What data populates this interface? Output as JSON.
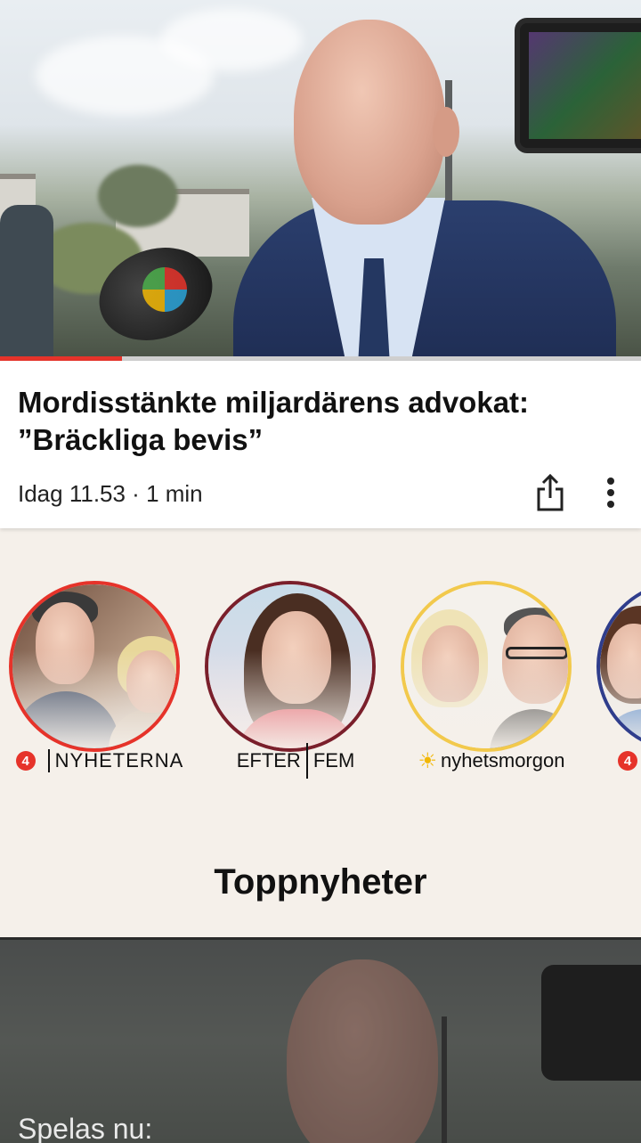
{
  "article": {
    "headline": "Mordisstänkte miljardärens advokat: ”Bräckliga bevis”",
    "meta": "Idag 11.53 · 1 min",
    "progress_percent": 19
  },
  "actions": {
    "share_icon": "share-icon",
    "more_icon": "more-vertical-icon"
  },
  "shows": [
    {
      "logo_badge": "4",
      "name": "NYHETERNA",
      "ring_color": "#e6332a"
    },
    {
      "name_left": "EFTER",
      "name_right": "FEM",
      "ring_color": "#7a1f2b"
    },
    {
      "name": "nyhetsmorgon",
      "ring_color": "#f2c94c"
    },
    {
      "logo_badge": "4",
      "ring_color": "#2f3d8c"
    }
  ],
  "section": {
    "title": "Toppnyheter"
  },
  "player": {
    "playing_label": "Spelas nu:"
  },
  "colors": {
    "accent": "#e6332a",
    "background": "#f5f0ea"
  }
}
